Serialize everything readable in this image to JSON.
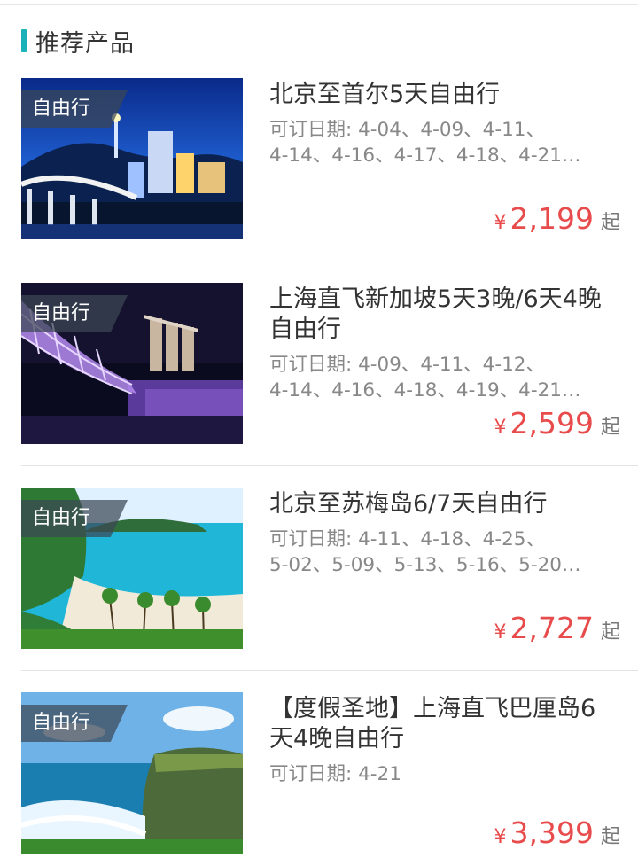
{
  "section": {
    "title": "推荐产品",
    "accent_color": "#1ab2b8"
  },
  "tag_label": "自由行",
  "price_color": "#e84b4b",
  "products": [
    {
      "title_lines": [
        "北京至首尔5天自由行"
      ],
      "date_label": "可订日期:",
      "dates_line1": "4-04、4-09、4-11、",
      "dates_line2": "4-14、4-16、4-17、4-18、4-21…",
      "currency": "¥",
      "price": "2,199",
      "suffix": "起"
    },
    {
      "title_lines": [
        "上海直飞新加坡5天3晚/6天4晚",
        "自由行"
      ],
      "date_label": "可订日期:",
      "dates_line1": "4-09、4-11、4-12、",
      "dates_line2": "4-14、4-16、4-18、4-19、4-21…",
      "currency": "¥",
      "price": "2,599",
      "suffix": "起"
    },
    {
      "title_lines": [
        "北京至苏梅岛6/7天自由行"
      ],
      "date_label": "可订日期:",
      "dates_line1": "4-11、4-18、4-25、",
      "dates_line2": "5-02、5-09、5-13、5-16、5-20…",
      "currency": "¥",
      "price": "2,727",
      "suffix": "起"
    },
    {
      "title_lines": [
        "【度假圣地】上海直飞巴厘岛6",
        "天4晚自由行"
      ],
      "date_label": "可订日期:",
      "dates_line1": "4-21",
      "dates_line2": "",
      "currency": "¥",
      "price": "3,399",
      "suffix": "起"
    }
  ]
}
